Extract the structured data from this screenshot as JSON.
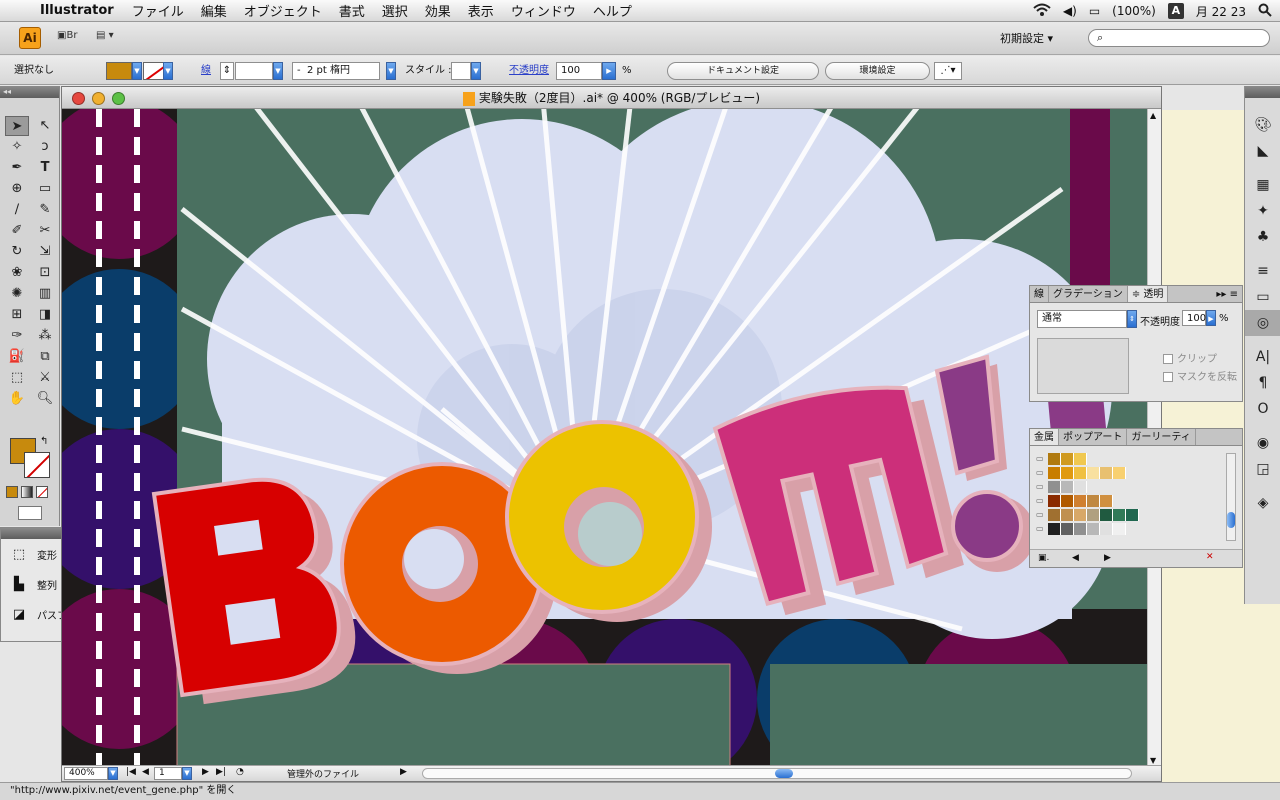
{
  "menubar": {
    "app_name": "Illustrator",
    "menus": [
      "ファイル",
      "編集",
      "オブジェクト",
      "書式",
      "選択",
      "効果",
      "表示",
      "ウィンドウ",
      "ヘルプ"
    ],
    "battery": "(100%)",
    "input_mode": "A",
    "clock": "月 22 23"
  },
  "appbar": {
    "logo": "Ai",
    "bridge": "Br",
    "workspace": "初期設定 ▾"
  },
  "control_bar": {
    "selection": "選択なし",
    "fill_color": "#c78a0d",
    "stroke_label": "線",
    "stroke_profile": "2 pt 楕円",
    "style_label": "スタイル :",
    "opacity_label": "不透明度",
    "opacity_value": "100",
    "percent": "%",
    "document_setup": "ドキュメント設定",
    "preferences": "環境設定"
  },
  "document": {
    "title": "実験失敗（2度目）.ai* @ 400% (RGB/プレビュー)",
    "zoom": "400%",
    "page": "1",
    "status": "管理外のファイル",
    "artwork_text": "BOOM!"
  },
  "transform_panel": {
    "items": [
      "変形",
      "整列",
      "パスファインダ"
    ]
  },
  "transparency_panel": {
    "tabs": [
      "線",
      "グラデーション",
      "≑ 透明"
    ],
    "blend_mode": "通常",
    "opacity_label": "不透明度 :",
    "opacity_value": "100",
    "percent": "%",
    "clip_label": "クリップ",
    "invert_label": "マスクを反転"
  },
  "swatches_panel": {
    "tabs": [
      "金属",
      "ポップアート",
      "ガーリーティ"
    ]
  },
  "url_status": "\"http://www.pixiv.net/event_gene.php\" を開く",
  "colors": {
    "canvas_bg": "#4a7060",
    "cloud": "#d8def2",
    "b": "#d70000",
    "o1": "#ec5a00",
    "o2": "#ecc200",
    "m": "#cc2f7a",
    "bang": "#8a3a86",
    "extrude": "#d8a0a8"
  }
}
